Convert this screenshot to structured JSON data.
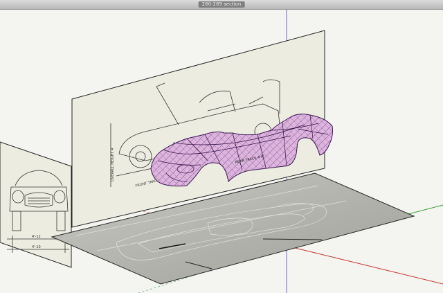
{
  "window": {
    "title": "260-289 section"
  },
  "scene": {
    "drawing_labels": {
      "overall_height": "OVERALL HEIGHT 4'",
      "front_track": "FRONT TRACK 4'3\"",
      "rear_track": "REAR TRACK 4'4\"",
      "front_dim_1": "4'-12",
      "front_dim_2": "4'-10"
    },
    "colors": {
      "background": "#f4f4f1",
      "plane_paper": "#ecece0",
      "plane_ground": "#a9a9a3",
      "mesh_fill": "#dcb4dc",
      "mesh_line": "#4a1f6a",
      "axis_red": "#c8322d",
      "axis_green": "#2ea02e",
      "axis_blue": "#6b6bd0"
    }
  }
}
